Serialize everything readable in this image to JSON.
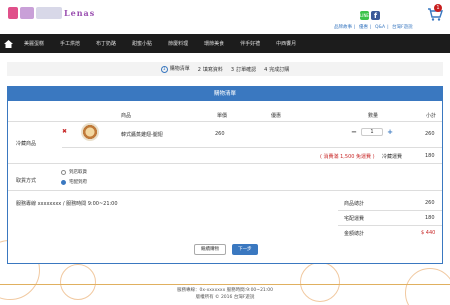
{
  "header": {
    "logo_text": "Lenas",
    "social": {
      "line": "LINE",
      "fb": "f"
    },
    "links": [
      "品牌故事",
      "優惠",
      "Q&A",
      "台灣F遊說"
    ],
    "cart_count": "1"
  },
  "nav": {
    "items": [
      "美麗蛋糕",
      "手工烘焙",
      "布丁奶酪",
      "甜蜜小點",
      "節慶料理",
      "環節美食",
      "伴手好禮",
      "中西饗月"
    ]
  },
  "steps": [
    {
      "num": "1",
      "label": "購物清單"
    },
    {
      "num": "2",
      "label": "填寫資料"
    },
    {
      "num": "3",
      "label": "訂單確認"
    },
    {
      "num": "4",
      "label": "完成訂購"
    }
  ],
  "cart": {
    "title": "購物清單",
    "headers": {
      "product": "商品",
      "unit_price": "單價",
      "discount": "優惠",
      "qty": "數量",
      "subtotal": "小計"
    },
    "section_label": "冷藏商品",
    "item": {
      "name": "韓式醬蒸雞翅-腿翅",
      "price": "260",
      "qty": "1",
      "subtotal": "260"
    },
    "shipping_note": "( 消費滿 1,500 免運費 )",
    "shipping_label": "冷藏運費",
    "shipping_fee": "180",
    "delivery_label": "取貨方式",
    "delivery_options": [
      {
        "label": "到店取貨",
        "selected": false
      },
      {
        "label": "宅配到府",
        "selected": true
      }
    ],
    "service_info": "服務專線 xxxxxxxx / 服務時間 9:00~21:00",
    "totals": [
      {
        "label": "商品總計",
        "value": "260",
        "emphasis": false
      },
      {
        "label": "宅配運費",
        "value": "180",
        "emphasis": false
      },
      {
        "label": "金額總計",
        "value": "$ 440",
        "emphasis": true
      }
    ],
    "continue_button": "繼續購物",
    "next_button": "下一步"
  },
  "footer": {
    "line1": "服務專線：0x-xxxxxxx  服務時間:9:00~21:00",
    "line2": "版權所有 © 2016 台灣F遊說"
  },
  "colors": {
    "accent": "#3a78c0",
    "nav": "#1c1c1c",
    "danger": "#c82828",
    "footer_line": "#e0b060"
  }
}
